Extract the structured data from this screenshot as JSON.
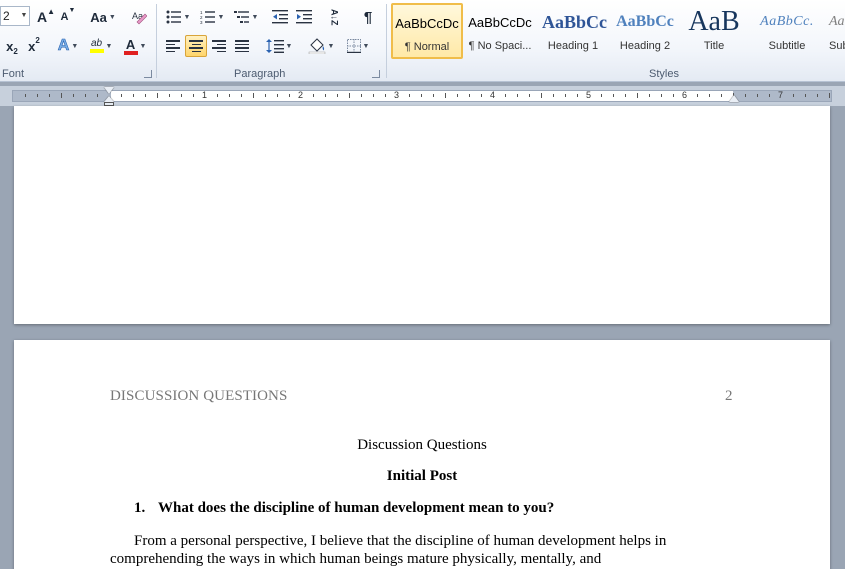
{
  "ribbon": {
    "font_group": {
      "label": "Font",
      "font_size_value": "2",
      "grow_font": "A",
      "shrink_font": "A",
      "change_case": "Aa",
      "subscript": "x",
      "subscript_mark": "2",
      "superscript": "x",
      "superscript_mark": "2",
      "text_effects": "A",
      "highlight": "ab",
      "font_color": "A",
      "font_color_swatch": "#e02020",
      "highlight_swatch": "#ffff00"
    },
    "paragraph_group": {
      "label": "Paragraph",
      "sort": "A↓Z",
      "show_marks": "¶",
      "active_alignment": "center"
    },
    "styles_group": {
      "label": "Styles",
      "tiles": [
        {
          "sample": "AaBbCcDc",
          "name": "¶ Normal"
        },
        {
          "sample": "AaBbCcDc",
          "name": "¶ No Spaci..."
        },
        {
          "sample": "AaBbCc",
          "name": "Heading 1"
        },
        {
          "sample": "AaBbCc",
          "name": "Heading 2"
        },
        {
          "sample": "AaB",
          "name": "Title"
        },
        {
          "sample": "AaBbCc.",
          "name": "Subtitle"
        },
        {
          "sample": "Aa",
          "name": "Sub"
        }
      ]
    }
  },
  "ruler": {
    "numbers": [
      "1",
      "2",
      "3",
      "4",
      "5",
      "6",
      "7"
    ]
  },
  "document": {
    "header_left": "DISCUSSION QUESTIONS",
    "page_number": "2",
    "title": "Discussion Questions",
    "subtitle": "Initial Post",
    "question_number": "1.",
    "question_text": "What does the discipline of human development mean to you?",
    "paragraph": "From a personal perspective, I believe that the discipline of human development helps in comprehending the ways in which human beings mature physically, mentally, and"
  }
}
